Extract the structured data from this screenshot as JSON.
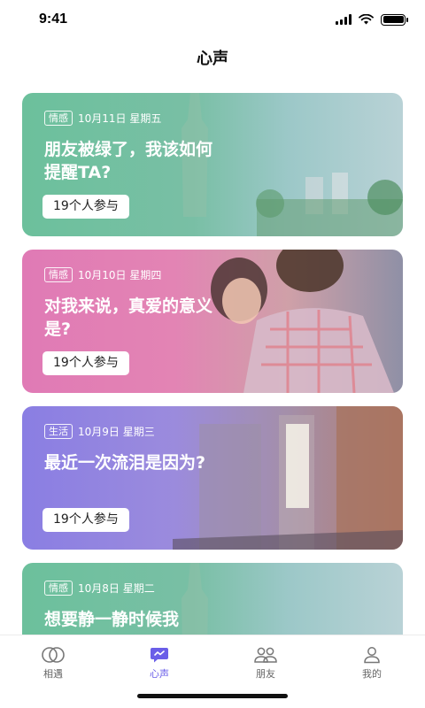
{
  "status_bar": {
    "time": "9:41"
  },
  "page": {
    "title": "心声"
  },
  "cards": [
    {
      "tag": "情感",
      "date": "10月11日 星期五",
      "title": "朋友被绿了，我该如何提醒TA?",
      "participants": "19个人参与"
    },
    {
      "tag": "情感",
      "date": "10月10日 星期四",
      "title": "对我来说，真爱的意义是?",
      "participants": "19个人参与"
    },
    {
      "tag": "生活",
      "date": "10月9日 星期三",
      "title": "最近一次流泪是因为?",
      "participants": "19个人参与"
    },
    {
      "tag": "情感",
      "date": "10月8日 星期二",
      "title": "想要静一静时候我",
      "participants": ""
    }
  ],
  "tabs": [
    {
      "label": "相遇",
      "icon": "rings-icon",
      "active": false
    },
    {
      "label": "心声",
      "icon": "chat-bubble-icon",
      "active": true
    },
    {
      "label": "朋友",
      "icon": "friends-icon",
      "active": false
    },
    {
      "label": "我的",
      "icon": "profile-icon",
      "active": false
    }
  ],
  "colors": {
    "accent": "#6a5ee8"
  }
}
